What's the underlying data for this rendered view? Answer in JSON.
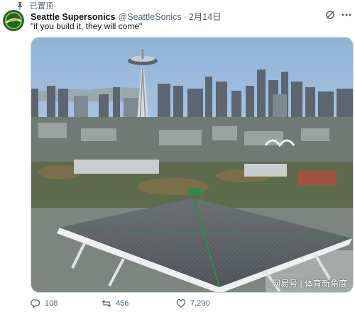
{
  "pinned": {
    "label": "已置顶",
    "icon": "pin-icon"
  },
  "author": {
    "display_name": "Seattle Supersonics",
    "handle": "@SeattleSonics",
    "separator": "·",
    "date": "2月14日",
    "avatar_colors": {
      "outer": "#0b6b3a",
      "ring": "#f2b705"
    }
  },
  "tweet": {
    "text": "\"if you build it, they will come\""
  },
  "media": {
    "watermark": "网易号 | 体育新角度"
  },
  "actions": {
    "reply": {
      "count": "108",
      "icon": "reply-icon"
    },
    "retweet": {
      "count": "456",
      "icon": "retweet-icon"
    },
    "like": {
      "count": "7,290",
      "icon": "heart-icon"
    }
  },
  "colors": {
    "text": "#0f1419",
    "secondary": "#536471",
    "border": "#cfd9de"
  }
}
